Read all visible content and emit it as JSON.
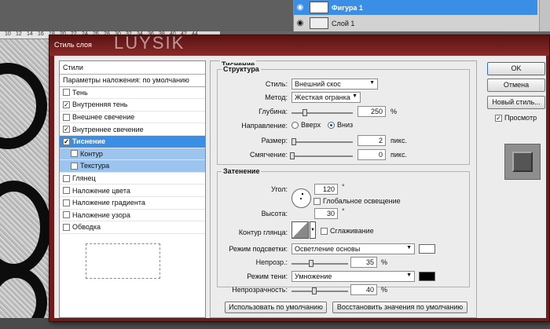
{
  "ruler": {
    "ticks": [
      "10",
      "12",
      "14",
      "16",
      "18",
      "20",
      "22",
      "24",
      "26",
      "28",
      "30",
      "32",
      "34",
      "36",
      "38",
      "40",
      "42",
      "44"
    ]
  },
  "layers": [
    {
      "name": "Фигура 1",
      "selected": true
    },
    {
      "name": "Слой 1",
      "selected": false
    }
  ],
  "dialog": {
    "title": "Стиль слоя",
    "watermark": "LUYSIK"
  },
  "styles_list": {
    "header": "Стили",
    "blending": "Параметры наложения: по умолчанию",
    "items": [
      {
        "label": "Тень",
        "checked": false
      },
      {
        "label": "Внутренняя тень",
        "checked": true
      },
      {
        "label": "Внешнее свечение",
        "checked": false
      },
      {
        "label": "Внутреннее свечение",
        "checked": true
      },
      {
        "label": "Тиснение",
        "checked": true,
        "active": true
      },
      {
        "label": "Контур",
        "checked": false,
        "sub": true
      },
      {
        "label": "Текстура",
        "checked": false,
        "sub": true
      },
      {
        "label": "Глянец",
        "checked": false
      },
      {
        "label": "Наложение цвета",
        "checked": false
      },
      {
        "label": "Наложение градиента",
        "checked": false
      },
      {
        "label": "Наложение узора",
        "checked": false
      },
      {
        "label": "Обводка",
        "checked": false
      }
    ]
  },
  "bevel": {
    "title": "Тиснение",
    "structure": {
      "title": "Структура",
      "style_label": "Стиль:",
      "style_value": "Внешний скос",
      "technique_label": "Метод:",
      "technique_value": "Жесткая огранка",
      "depth_label": "Глубина:",
      "depth_value": "250",
      "depth_unit": "%",
      "direction_label": "Направление:",
      "direction_up": "Вверх",
      "direction_down": "Вниз",
      "direction_selected": "down",
      "size_label": "Размер:",
      "size_value": "2",
      "size_unit": "пикс.",
      "soften_label": "Смягчение:",
      "soften_value": "0",
      "soften_unit": "пикс."
    },
    "shading": {
      "title": "Затенение",
      "angle_label": "Угол:",
      "angle_value": "120",
      "angle_unit": "°",
      "global_light_label": "Глобальное освещение",
      "altitude_label": "Высота:",
      "altitude_value": "30",
      "altitude_unit": "°",
      "gloss_contour_label": "Контур глянца:",
      "antialias_label": "Сглаживание",
      "highlight_mode_label": "Режим подсветки:",
      "highlight_mode_value": "Осветление основы",
      "highlight_color": "#ffffff",
      "highlight_opacity_label": "Непрозр.:",
      "highlight_opacity_value": "35",
      "highlight_opacity_unit": "%",
      "shadow_mode_label": "Режим тени:",
      "shadow_mode_value": "Умножение",
      "shadow_color": "#000000",
      "shadow_opacity_label": "Непрозрачность:",
      "shadow_opacity_value": "40",
      "shadow_opacity_unit": "%"
    },
    "make_default_label": "Использовать по умолчанию",
    "reset_default_label": "Восстановить значения по умолчанию"
  },
  "buttons": {
    "ok": "OK",
    "cancel": "Отмена",
    "new_style": "Новый стиль...",
    "preview_label": "Просмотр"
  }
}
